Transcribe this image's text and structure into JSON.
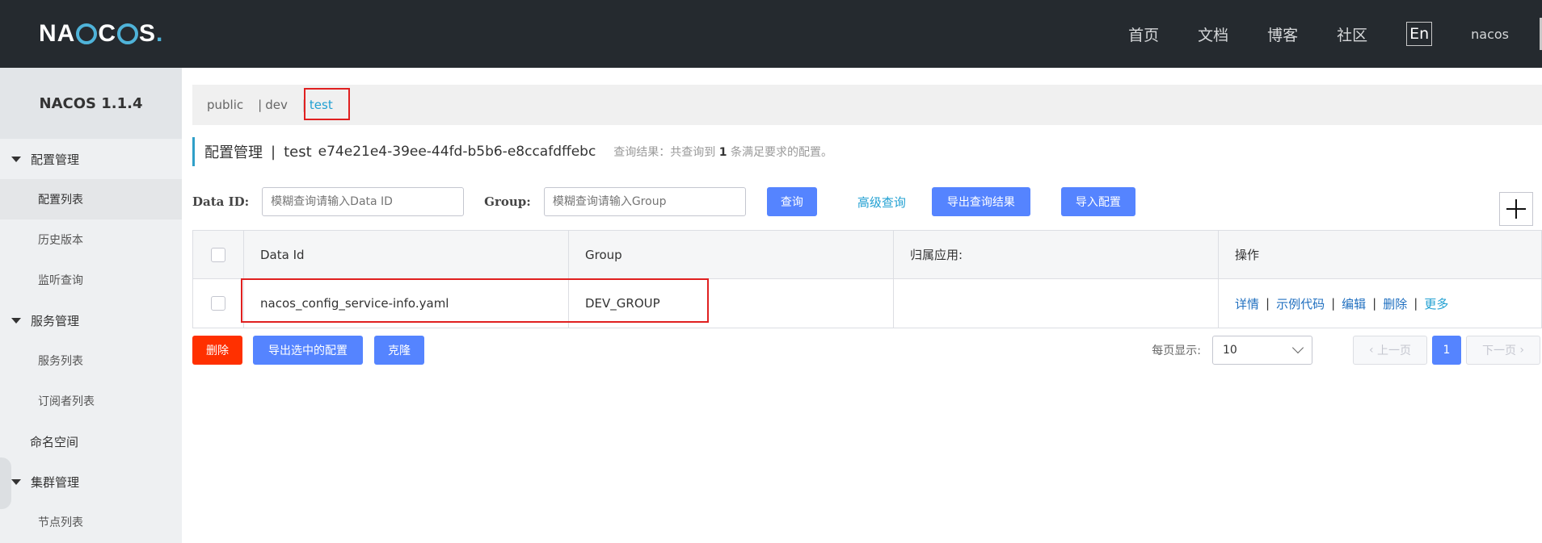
{
  "header": {
    "logo_text": "NACOS.",
    "nav": [
      "首页",
      "文档",
      "博客",
      "社区"
    ],
    "lang": "En",
    "user": "nacos"
  },
  "sidebar": {
    "version": "NACOS 1.1.4",
    "groups": [
      {
        "label": "配置管理",
        "items": [
          "配置列表",
          "历史版本",
          "监听查询"
        ]
      },
      {
        "label": "服务管理",
        "items": [
          "服务列表",
          "订阅者列表"
        ]
      }
    ],
    "namespace": "命名空间",
    "cluster": {
      "label": "集群管理",
      "items": [
        "节点列表"
      ]
    }
  },
  "namespaces": [
    "public",
    "dev",
    "test"
  ],
  "title": {
    "main": "配置管理",
    "ns": "test",
    "ns_id": "e74e21e4-39ee-44fd-b5b6-e8ccafdffebc",
    "hint_prefix": "查询结果：共查询到",
    "hint_count": "1",
    "hint_suffix": "条满足要求的配置。"
  },
  "search": {
    "dataid_label": "Data ID:",
    "dataid_placeholder": "模糊查询请输入Data ID",
    "group_label": "Group:",
    "group_placeholder": "模糊查询请输入Group",
    "query_btn": "查询",
    "advanced": "高级查询",
    "export_btn": "导出查询结果",
    "import_btn": "导入配置"
  },
  "table": {
    "headers": [
      "Data Id",
      "Group",
      "归属应用:",
      "操作"
    ],
    "rows": [
      {
        "data_id": "nacos_config_service-info.yaml",
        "group": "DEV_GROUP",
        "app": ""
      }
    ],
    "ops": [
      "详情",
      "示例代码",
      "编辑",
      "删除",
      "更多"
    ]
  },
  "actions": {
    "delete": "删除",
    "export_selected": "导出选中的配置",
    "clone": "克隆"
  },
  "pager": {
    "page_size_label": "每页显示:",
    "page_size": "10",
    "prev": "上一页",
    "current": "1",
    "next": "下一页"
  }
}
